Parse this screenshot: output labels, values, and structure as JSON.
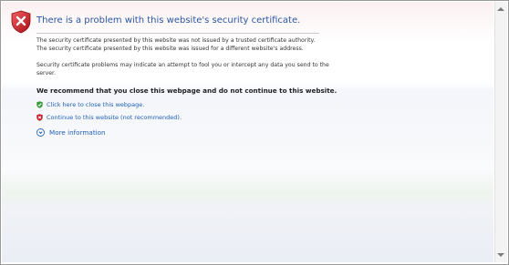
{
  "page": {
    "title": "There is a problem with this website's security certificate.",
    "paragraph1_line1": "The security certificate presented by this website was not issued by a trusted certificate authority.",
    "paragraph1_line2": "The security certificate presented by this website was issued for a different website's address.",
    "paragraph2_line1": "Security certificate problems may indicate an attempt to fool you or intercept any data you send to the",
    "paragraph2_line2": "server.",
    "recommendation": "We recommend that you close this webpage and do not continue to this website.",
    "close_link": "Click here to close this webpage.",
    "continue_link": "Continue to this website (not recommended).",
    "more_info": "More information"
  },
  "icons": {
    "header": "error-shield-icon",
    "close": "green-shield-check-icon",
    "continue": "red-shield-x-icon",
    "more_info": "expand-circle-icon"
  },
  "colors": {
    "title": "#2a55a0",
    "link": "#1f5fb4",
    "error_red": "#c8202a",
    "safe_green": "#3a9a3a"
  }
}
